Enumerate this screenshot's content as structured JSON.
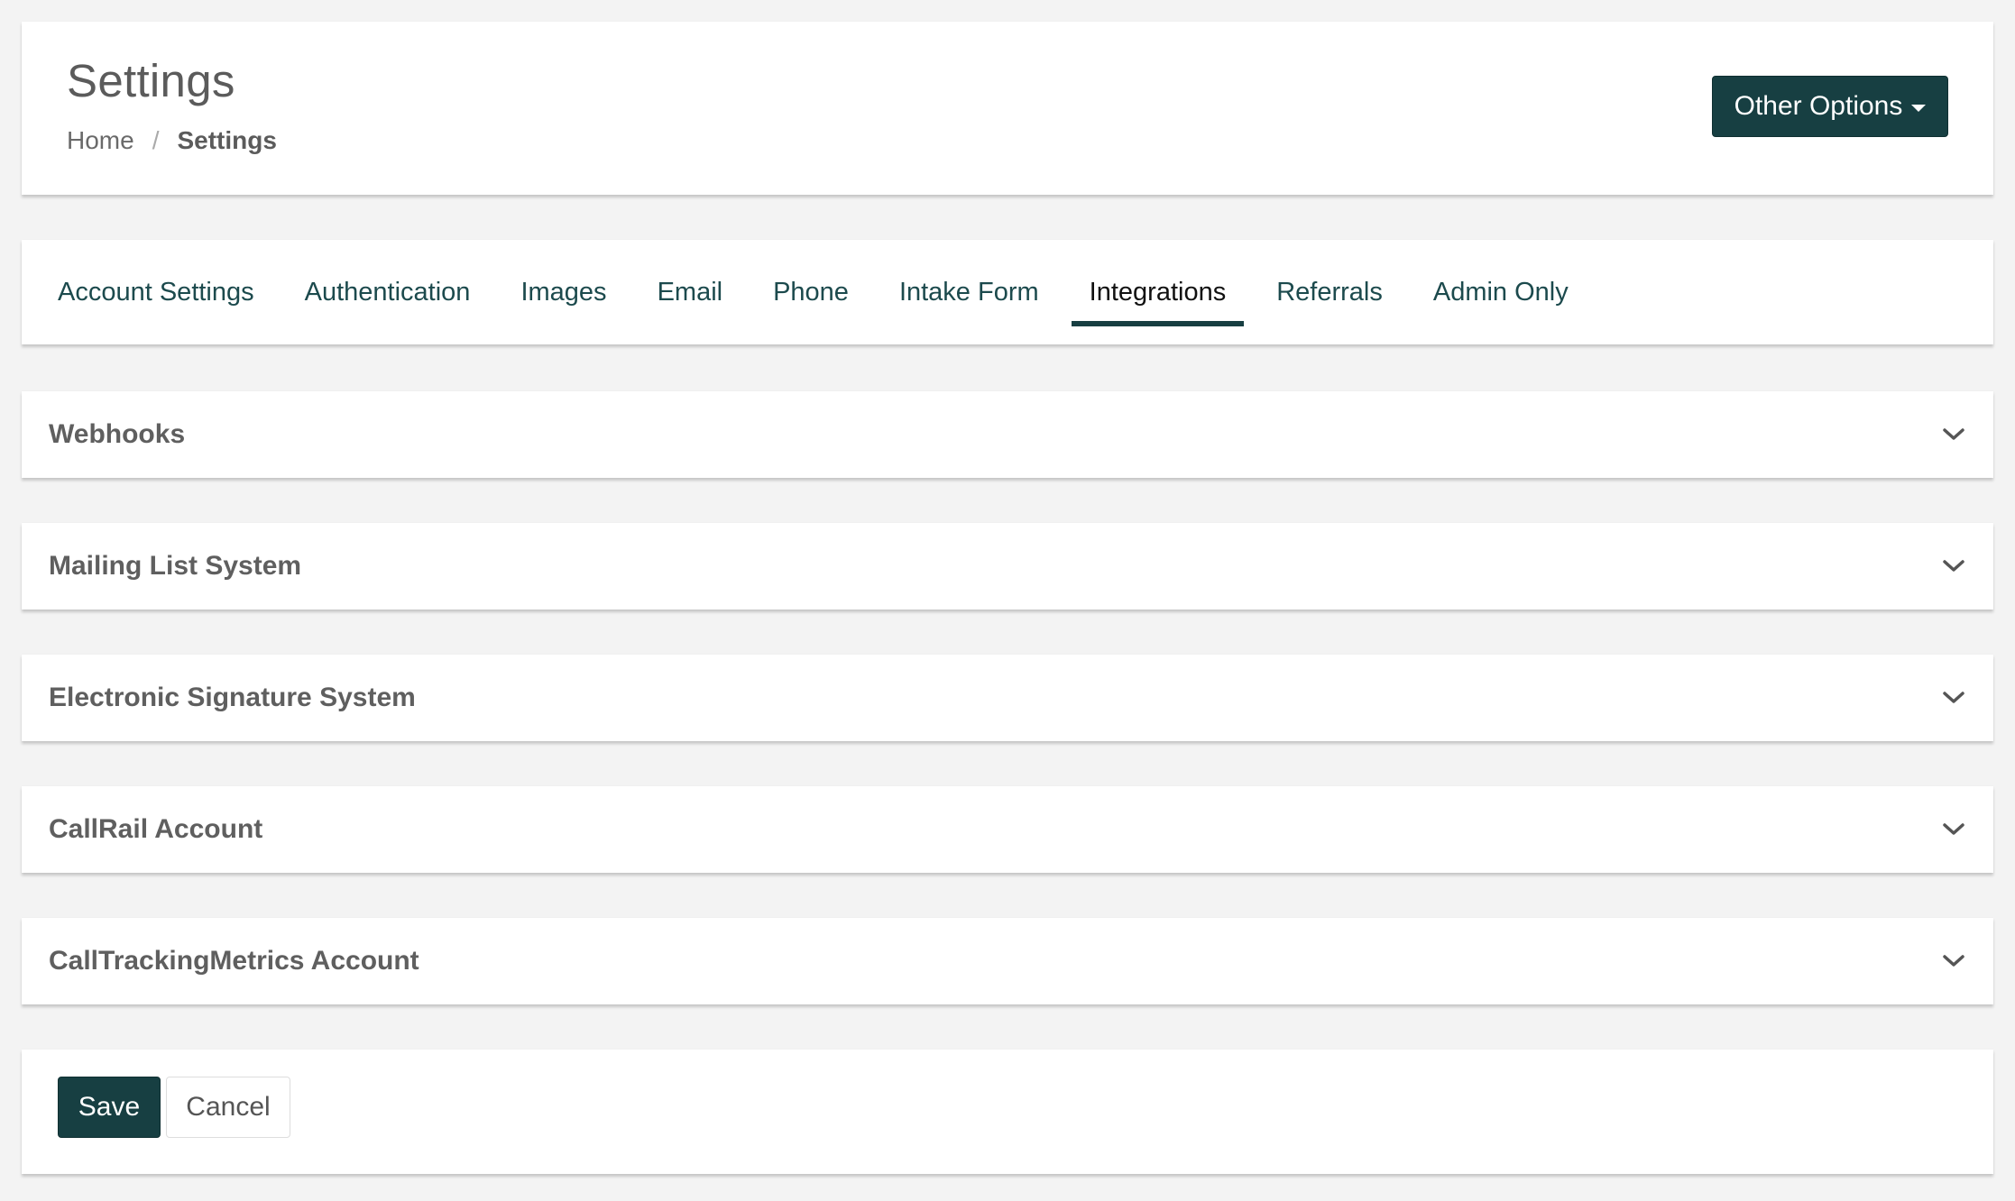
{
  "header": {
    "title": "Settings",
    "breadcrumb": {
      "home": "Home",
      "separator": "/",
      "current": "Settings"
    },
    "other_options_label": "Other Options"
  },
  "tabs": [
    {
      "label": "Account Settings",
      "active": false
    },
    {
      "label": "Authentication",
      "active": false
    },
    {
      "label": "Images",
      "active": false
    },
    {
      "label": "Email",
      "active": false
    },
    {
      "label": "Phone",
      "active": false
    },
    {
      "label": "Intake Form",
      "active": false
    },
    {
      "label": "Integrations",
      "active": true
    },
    {
      "label": "Referrals",
      "active": false
    },
    {
      "label": "Admin Only",
      "active": false
    }
  ],
  "panels": [
    {
      "title": "Webhooks",
      "icon": "chevron-down-icon"
    },
    {
      "title": "Mailing List System",
      "icon": "chevron-down-icon"
    },
    {
      "title": "Electronic Signature System",
      "icon": "chevron-down-icon"
    },
    {
      "title": "CallRail Account",
      "icon": "chevron-down-icon"
    },
    {
      "title": "CallTrackingMetrics Account",
      "icon": "chevron-down-icon"
    }
  ],
  "footer": {
    "save_label": "Save",
    "cancel_label": "Cancel"
  },
  "colors": {
    "accent": "#173f42",
    "background": "#f3f3f3",
    "card": "#ffffff"
  }
}
